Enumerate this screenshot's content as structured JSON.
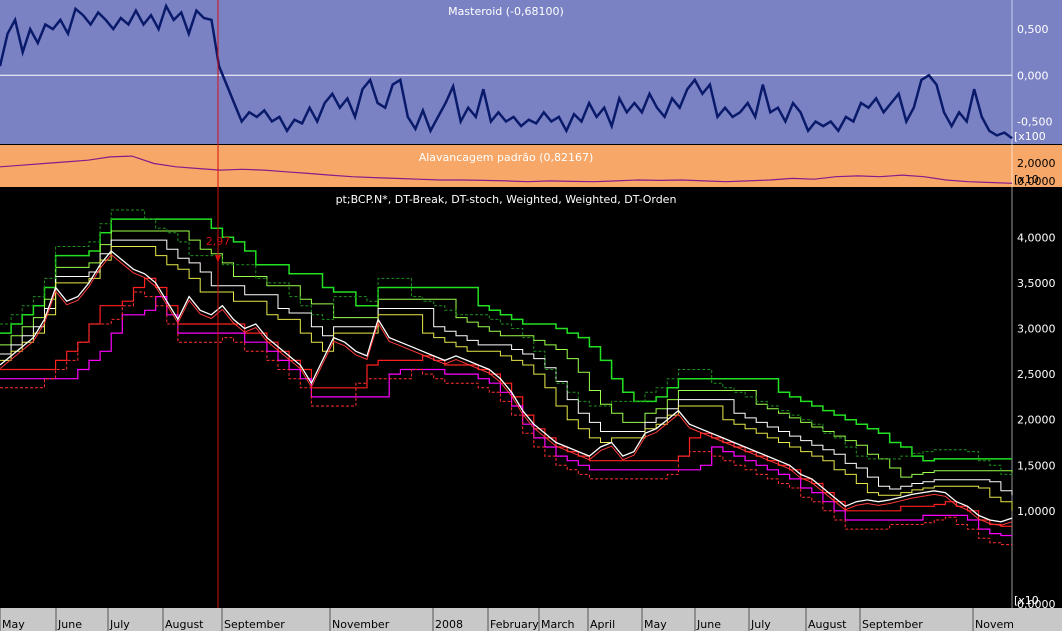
{
  "colors": {
    "top_bg": "#7b82c4",
    "mid_bg": "#f7a869",
    "main_bg": "#000000",
    "axis_bg": "#c8c8c8",
    "masteroid_line": "#0a1a6b",
    "leverage_line": "#8a1a8a",
    "marker": "#d01010"
  },
  "top_panel": {
    "title": "Masteroid (-0,68100)",
    "y_ticks": [
      "0,500",
      "0,000",
      "-0,500"
    ],
    "scale_tag": "x100"
  },
  "mid_panel": {
    "title": "Alavancagem padrão (0,82167)",
    "y_ticks": [
      "2,0000",
      "0,0000"
    ],
    "scale_tag": "x10"
  },
  "main_panel": {
    "title": "pt;BCP.N*, DT-Break, DT-stoch, Weighted, Weighted, DT-Orden",
    "y_ticks": [
      "4,0000",
      "3,5000",
      "3,0000",
      "2,5000",
      "2,0000",
      "1,5000",
      "1,0000",
      "0,0000"
    ],
    "scale_tag": "x10",
    "marker_label": "2,97"
  },
  "x_axis": {
    "labels": [
      "May",
      "June",
      "July",
      "August",
      "September",
      "November",
      "2008",
      "February",
      "March",
      "April",
      "May",
      "June",
      "July",
      "August",
      "September",
      "Novem"
    ]
  },
  "chart_data": [
    {
      "type": "line",
      "title": "Masteroid (-0,68100)",
      "ylim": [
        -0.7,
        0.75
      ],
      "series": [
        {
          "values": [
            0.1,
            0.45,
            0.6,
            0.25,
            0.5,
            0.35,
            0.55,
            0.5,
            0.6,
            0.45,
            0.72,
            0.65,
            0.55,
            0.68,
            0.6,
            0.5,
            0.62,
            0.55,
            0.7,
            0.55,
            0.65,
            0.5,
            0.75,
            0.6,
            0.68,
            0.45,
            0.7,
            0.62,
            0.6,
            0.1,
            -0.1,
            -0.3,
            -0.5,
            -0.4,
            -0.45,
            -0.38,
            -0.5,
            -0.45,
            -0.6,
            -0.48,
            -0.52,
            -0.35,
            -0.5,
            -0.3,
            -0.2,
            -0.35,
            -0.25,
            -0.45,
            -0.15,
            -0.05,
            -0.3,
            -0.35,
            -0.1,
            -0.05,
            -0.45,
            -0.58,
            -0.38,
            -0.6,
            -0.45,
            -0.3,
            -0.12,
            -0.5,
            -0.35,
            -0.45,
            -0.15,
            -0.5,
            -0.4,
            -0.5,
            -0.45,
            -0.55,
            -0.48,
            -0.52,
            -0.4,
            -0.5,
            -0.45,
            -0.6,
            -0.42,
            -0.5,
            -0.3,
            -0.45,
            -0.35,
            -0.55,
            -0.25,
            -0.4,
            -0.3,
            -0.4,
            -0.2,
            -0.35,
            -0.45,
            -0.25,
            -0.35,
            -0.15,
            -0.05,
            -0.2,
            -0.1,
            -0.45,
            -0.35,
            -0.45,
            -0.4,
            -0.3,
            -0.45,
            -0.1,
            -0.4,
            -0.35,
            -0.5,
            -0.3,
            -0.4,
            -0.6,
            -0.5,
            -0.55,
            -0.5,
            -0.6,
            -0.45,
            -0.5,
            -0.3,
            -0.35,
            -0.25,
            -0.4,
            -0.3,
            -0.2,
            -0.5,
            -0.35,
            -0.05,
            0.0,
            -0.1,
            -0.4,
            -0.55,
            -0.4,
            -0.5,
            -0.15,
            -0.45,
            -0.6,
            -0.65,
            -0.62,
            -0.68
          ]
        }
      ]
    },
    {
      "type": "line",
      "title": "Alavancagem padrão (0,82167)",
      "ylim": [
        0.0,
        2.3
      ],
      "series": [
        {
          "values": [
            1.1,
            1.2,
            1.3,
            1.4,
            1.5,
            1.7,
            1.75,
            1.3,
            1.1,
            1.0,
            0.9,
            0.95,
            0.9,
            0.8,
            0.7,
            0.6,
            0.5,
            0.45,
            0.4,
            0.35,
            0.3,
            0.3,
            0.28,
            0.25,
            0.2,
            0.25,
            0.22,
            0.2,
            0.25,
            0.3,
            0.28,
            0.3,
            0.25,
            0.2,
            0.25,
            0.3,
            0.4,
            0.35,
            0.5,
            0.55,
            0.5,
            0.6,
            0.5,
            0.3,
            0.2,
            0.15,
            0.1
          ]
        }
      ]
    },
    {
      "type": "line",
      "title": "pt;BCP.N*, DT-Break, DT-stoch, Weighted, Weighted, DT-Orden",
      "ylim": [
        0.0,
        4.3
      ],
      "series": [
        {
          "values": [
            2.6,
            2.7,
            2.8,
            2.9,
            3.1,
            3.45,
            3.3,
            3.35,
            3.5,
            3.7,
            3.85,
            3.75,
            3.65,
            3.6,
            3.5,
            3.3,
            3.1,
            3.35,
            3.2,
            3.15,
            3.25,
            3.1,
            3.0,
            3.05,
            2.9,
            2.8,
            2.7,
            2.6,
            2.4,
            2.65,
            2.9,
            2.85,
            2.75,
            2.7,
            3.1,
            2.9,
            2.85,
            2.8,
            2.75,
            2.7,
            2.65,
            2.7,
            2.65,
            2.6,
            2.55,
            2.45,
            2.3,
            2.1,
            1.95,
            1.85,
            1.75,
            1.7,
            1.65,
            1.6,
            1.7,
            1.75,
            1.6,
            1.65,
            1.85,
            1.9,
            2.0,
            2.1,
            1.95,
            1.9,
            1.85,
            1.8,
            1.75,
            1.7,
            1.65,
            1.6,
            1.55,
            1.5,
            1.4,
            1.35,
            1.25,
            1.15,
            1.05,
            1.1,
            1.12,
            1.1,
            1.12,
            1.15,
            1.18,
            1.2,
            1.22,
            1.2,
            1.1,
            1.05,
            0.95,
            0.9,
            0.88,
            0.92
          ]
        }
      ]
    }
  ]
}
